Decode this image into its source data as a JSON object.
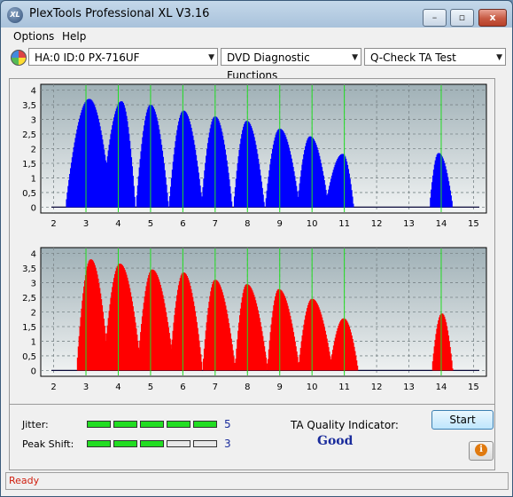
{
  "window": {
    "title": "PlexTools Professional XL V3.16",
    "minimize": "–",
    "restore": "▫",
    "close": "x"
  },
  "menu": [
    "Options",
    "Help"
  ],
  "toolbar": {
    "drive": "HA:0 ID:0  PX-716UF",
    "function": "DVD Diagnostic Functions",
    "test": "Q-Check TA Test"
  },
  "chart_data": [
    {
      "type": "bar",
      "name": "top",
      "color": "#0000ff",
      "xticks": [
        2,
        3,
        4,
        5,
        6,
        7,
        8,
        9,
        10,
        11,
        12,
        13,
        14,
        15
      ],
      "yticks": [
        "0",
        "0,5",
        "1",
        "1,5",
        "2",
        "2,5",
        "3",
        "3,5",
        "4"
      ],
      "xlim": [
        1.6,
        15.4
      ],
      "ylim": [
        -0.2,
        4.2
      ],
      "grid": true,
      "green_markers": [
        3,
        4,
        5,
        6,
        7,
        8,
        9,
        10,
        11,
        14
      ],
      "bumps": [
        {
          "from": 2.38,
          "peak_x": 3.1,
          "peak": 3.7,
          "to": 3.78
        },
        {
          "from": 3.5,
          "peak_x": 4.1,
          "peak": 3.62,
          "to": 4.52
        },
        {
          "from": 4.56,
          "peak_x": 5.0,
          "peak": 3.5,
          "to": 5.55
        },
        {
          "from": 5.58,
          "peak_x": 6.02,
          "peak": 3.3,
          "to": 6.6
        },
        {
          "from": 6.58,
          "peak_x": 7.0,
          "peak": 3.1,
          "to": 7.52
        },
        {
          "from": 7.58,
          "peak_x": 7.98,
          "peak": 2.95,
          "to": 8.52
        },
        {
          "from": 8.56,
          "peak_x": 9.0,
          "peak": 2.68,
          "to": 9.6
        },
        {
          "from": 9.55,
          "peak_x": 9.94,
          "peak": 2.42,
          "to": 10.5
        },
        {
          "from": 10.42,
          "peak_x": 10.95,
          "peak": 1.82,
          "to": 11.28
        },
        {
          "from": 13.65,
          "peak_x": 13.92,
          "peak": 1.85,
          "to": 14.35
        }
      ]
    },
    {
      "type": "bar",
      "name": "bottom",
      "color": "#ff0000",
      "xticks": [
        2,
        3,
        4,
        5,
        6,
        7,
        8,
        9,
        10,
        11,
        12,
        13,
        14,
        15
      ],
      "yticks": [
        "0",
        "0,5",
        "1",
        "1,5",
        "2",
        "2,5",
        "3",
        "3,5",
        "4"
      ],
      "xlim": [
        1.6,
        15.4
      ],
      "ylim": [
        -0.2,
        4.2
      ],
      "grid": true,
      "green_markers": [
        3,
        4,
        5,
        6,
        7,
        8,
        9,
        10,
        11,
        14
      ],
      "bumps": [
        {
          "from": 2.72,
          "peak_x": 3.15,
          "peak": 3.8,
          "to": 3.7
        },
        {
          "from": 3.55,
          "peak_x": 4.05,
          "peak": 3.65,
          "to": 4.7
        },
        {
          "from": 4.6,
          "peak_x": 5.05,
          "peak": 3.45,
          "to": 5.72
        },
        {
          "from": 5.6,
          "peak_x": 6.02,
          "peak": 3.35,
          "to": 6.6
        },
        {
          "from": 6.62,
          "peak_x": 7.0,
          "peak": 3.1,
          "to": 7.62
        },
        {
          "from": 7.62,
          "peak_x": 7.98,
          "peak": 2.95,
          "to": 8.62
        },
        {
          "from": 8.62,
          "peak_x": 8.97,
          "peak": 2.78,
          "to": 9.6
        },
        {
          "from": 9.58,
          "peak_x": 10.0,
          "peak": 2.45,
          "to": 10.62
        },
        {
          "from": 10.55,
          "peak_x": 10.98,
          "peak": 1.78,
          "to": 11.42
        },
        {
          "from": 13.72,
          "peak_x": 14.02,
          "peak": 1.95,
          "to": 14.35
        }
      ]
    }
  ],
  "summary": {
    "jitter_label": "Jitter:",
    "jitter_value": "5",
    "jitter_level": 5,
    "peakshift_label": "Peak Shift:",
    "peakshift_value": "3",
    "peakshift_level": 3,
    "ta_label": "TA Quality Indicator:",
    "ta_value": "Good",
    "start_label": "Start",
    "info_icon": "i"
  },
  "status": "Ready"
}
